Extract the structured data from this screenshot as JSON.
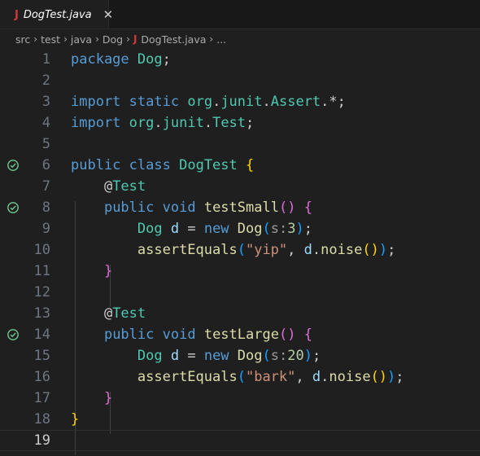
{
  "tab": {
    "icon": "J",
    "filename": "DogTest.java",
    "close_glyph": "✕"
  },
  "breadcrumb": {
    "items": [
      "src",
      "test",
      "java",
      "Dog"
    ],
    "file_icon": "J",
    "file": "DogTest.java",
    "more": "..."
  },
  "editor": {
    "current_line": 19,
    "lines": [
      {
        "num": "1",
        "tokens": [
          [
            "kw",
            "package"
          ],
          [
            "pl",
            " "
          ],
          [
            "ty",
            "Dog"
          ],
          [
            "pl",
            ";"
          ]
        ]
      },
      {
        "num": "2",
        "tokens": []
      },
      {
        "num": "3",
        "tokens": [
          [
            "kw",
            "import"
          ],
          [
            "pl",
            " "
          ],
          [
            "kw",
            "static"
          ],
          [
            "pl",
            " "
          ],
          [
            "ty",
            "org"
          ],
          [
            "pl",
            "."
          ],
          [
            "ty",
            "junit"
          ],
          [
            "pl",
            "."
          ],
          [
            "ty",
            "Assert"
          ],
          [
            "pl",
            ".*;"
          ]
        ]
      },
      {
        "num": "4",
        "tokens": [
          [
            "kw",
            "import"
          ],
          [
            "pl",
            " "
          ],
          [
            "ty",
            "org"
          ],
          [
            "pl",
            "."
          ],
          [
            "ty",
            "junit"
          ],
          [
            "pl",
            "."
          ],
          [
            "ty",
            "Test"
          ],
          [
            "pl",
            ";"
          ]
        ]
      },
      {
        "num": "5",
        "tokens": []
      },
      {
        "num": "6",
        "test_icon": "check-circle-icon",
        "tokens": [
          [
            "kw",
            "public"
          ],
          [
            "pl",
            " "
          ],
          [
            "kw",
            "class"
          ],
          [
            "pl",
            " "
          ],
          [
            "ty",
            "DogTest"
          ],
          [
            "pl",
            " "
          ],
          [
            "b1",
            "{"
          ]
        ]
      },
      {
        "num": "7",
        "tokens": [
          [
            "pl",
            "    @"
          ],
          [
            "ty",
            "Test"
          ]
        ]
      },
      {
        "num": "8",
        "test_icon": "check-circle-icon",
        "tokens": [
          [
            "pl",
            "    "
          ],
          [
            "kw",
            "public"
          ],
          [
            "pl",
            " "
          ],
          [
            "kw",
            "void"
          ],
          [
            "pl",
            " "
          ],
          [
            "fn",
            "testSmall"
          ],
          [
            "b2",
            "()"
          ],
          [
            "pl",
            " "
          ],
          [
            "b2",
            "{"
          ]
        ]
      },
      {
        "num": "9",
        "tokens": [
          [
            "pl",
            "        "
          ],
          [
            "ty",
            "Dog"
          ],
          [
            "pl",
            " "
          ],
          [
            "var",
            "d"
          ],
          [
            "pl",
            " = "
          ],
          [
            "kw",
            "new"
          ],
          [
            "pl",
            " "
          ],
          [
            "fn",
            "Dog"
          ],
          [
            "b3",
            "("
          ],
          [
            "hint",
            "s:"
          ],
          [
            "num",
            "3"
          ],
          [
            "b3",
            ")"
          ],
          [
            "pl",
            ";"
          ]
        ]
      },
      {
        "num": "10",
        "tokens": [
          [
            "pl",
            "        "
          ],
          [
            "fn",
            "assertEquals"
          ],
          [
            "b3",
            "("
          ],
          [
            "str",
            "\"yip\""
          ],
          [
            "pl",
            ", "
          ],
          [
            "var",
            "d"
          ],
          [
            "pl",
            "."
          ],
          [
            "fn",
            "noise"
          ],
          [
            "b1",
            "()"
          ],
          [
            "b3",
            ")"
          ],
          [
            "pl",
            ";"
          ]
        ]
      },
      {
        "num": "11",
        "tokens": [
          [
            "pl",
            "    "
          ],
          [
            "b2",
            "}"
          ]
        ]
      },
      {
        "num": "12",
        "tokens": []
      },
      {
        "num": "13",
        "tokens": [
          [
            "pl",
            "    @"
          ],
          [
            "ty",
            "Test"
          ]
        ]
      },
      {
        "num": "14",
        "test_icon": "check-circle-icon",
        "tokens": [
          [
            "pl",
            "    "
          ],
          [
            "kw",
            "public"
          ],
          [
            "pl",
            " "
          ],
          [
            "kw",
            "void"
          ],
          [
            "pl",
            " "
          ],
          [
            "fn",
            "testLarge"
          ],
          [
            "b2",
            "()"
          ],
          [
            "pl",
            " "
          ],
          [
            "b2",
            "{"
          ]
        ]
      },
      {
        "num": "15",
        "tokens": [
          [
            "pl",
            "        "
          ],
          [
            "ty",
            "Dog"
          ],
          [
            "pl",
            " "
          ],
          [
            "var",
            "d"
          ],
          [
            "pl",
            " = "
          ],
          [
            "kw",
            "new"
          ],
          [
            "pl",
            " "
          ],
          [
            "fn",
            "Dog"
          ],
          [
            "b3",
            "("
          ],
          [
            "hint",
            "s:"
          ],
          [
            "num",
            "20"
          ],
          [
            "b3",
            ")"
          ],
          [
            "pl",
            ";"
          ]
        ]
      },
      {
        "num": "16",
        "tokens": [
          [
            "pl",
            "        "
          ],
          [
            "fn",
            "assertEquals"
          ],
          [
            "b3",
            "("
          ],
          [
            "str",
            "\"bark\""
          ],
          [
            "pl",
            ", "
          ],
          [
            "var",
            "d"
          ],
          [
            "pl",
            "."
          ],
          [
            "fn",
            "noise"
          ],
          [
            "b1",
            "()"
          ],
          [
            "b3",
            ")"
          ],
          [
            "pl",
            ";"
          ]
        ]
      },
      {
        "num": "17",
        "tokens": [
          [
            "pl",
            "    "
          ],
          [
            "b2",
            "}"
          ]
        ]
      },
      {
        "num": "18",
        "tokens": [
          [
            "b1",
            "}"
          ]
        ]
      },
      {
        "num": "19",
        "tokens": []
      }
    ]
  },
  "colors": {
    "editor_bg": "#1f1f1f",
    "keyword": "#569cd6",
    "type": "#4ec9b0",
    "function": "#dcdcaa",
    "string": "#ce9178",
    "number": "#b5cea8",
    "variable": "#9cdcfe",
    "test_pass": "#73c991",
    "java_icon": "#d03a3a"
  }
}
